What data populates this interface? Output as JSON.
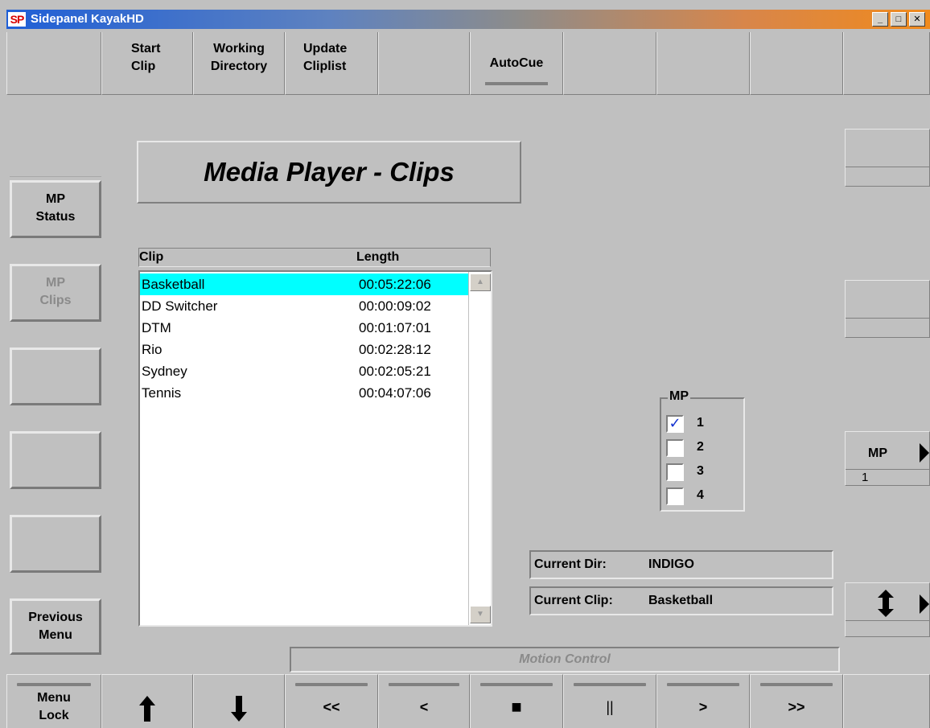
{
  "window": {
    "icon": "SP",
    "title": "Sidepanel KayakHD",
    "controls": {
      "minimize": "_",
      "maximize": "□",
      "close": "✕"
    }
  },
  "toolbar": {
    "start_clip": "Start\nClip",
    "working_directory": "Working\nDirectory",
    "update_cliplist": "Update\nCliplist",
    "autocue": "AutoCue"
  },
  "sidebar": {
    "mp_status": "MP\nStatus",
    "mp_clips": "MP\nClips",
    "previous_menu": "Previous\nMenu"
  },
  "main": {
    "title": "Media Player - Clips",
    "columns": [
      "Clip",
      "Length"
    ],
    "clips": [
      {
        "name": "Basketball",
        "length": "00:05:22:06",
        "selected": true
      },
      {
        "name": "DD Switcher",
        "length": "00:00:09:02",
        "selected": false
      },
      {
        "name": "DTM",
        "length": "00:01:07:01",
        "selected": false
      },
      {
        "name": "Rio",
        "length": "00:02:28:12",
        "selected": false
      },
      {
        "name": "Sydney",
        "length": "00:02:05:21",
        "selected": false
      },
      {
        "name": "Tennis",
        "length": "00:04:07:06",
        "selected": false
      }
    ],
    "mp_group": {
      "label": "MP",
      "options": [
        {
          "label": "1",
          "checked": true
        },
        {
          "label": "2",
          "checked": false
        },
        {
          "label": "3",
          "checked": false
        },
        {
          "label": "4",
          "checked": false
        }
      ]
    },
    "current_dir_label": "Current Dir:",
    "current_dir_value": "INDIGO",
    "current_clip_label": "Current Clip:",
    "current_clip_value": "Basketball",
    "motion_control": "Motion Control"
  },
  "right_panel": {
    "mp_label": "MP",
    "mp_value": "1"
  },
  "bottom_bar": {
    "menu_lock": "Menu\nLock",
    "up": "up-arrow-icon",
    "down": "down-arrow-icon",
    "rewind_fast": "<<",
    "rewind": "<",
    "stop": "■",
    "pause": "||",
    "play": ">",
    "forward_fast": ">>"
  },
  "colors": {
    "selection": "#00ffff",
    "check": "#1030d0",
    "panel": "#c0c0c0"
  }
}
